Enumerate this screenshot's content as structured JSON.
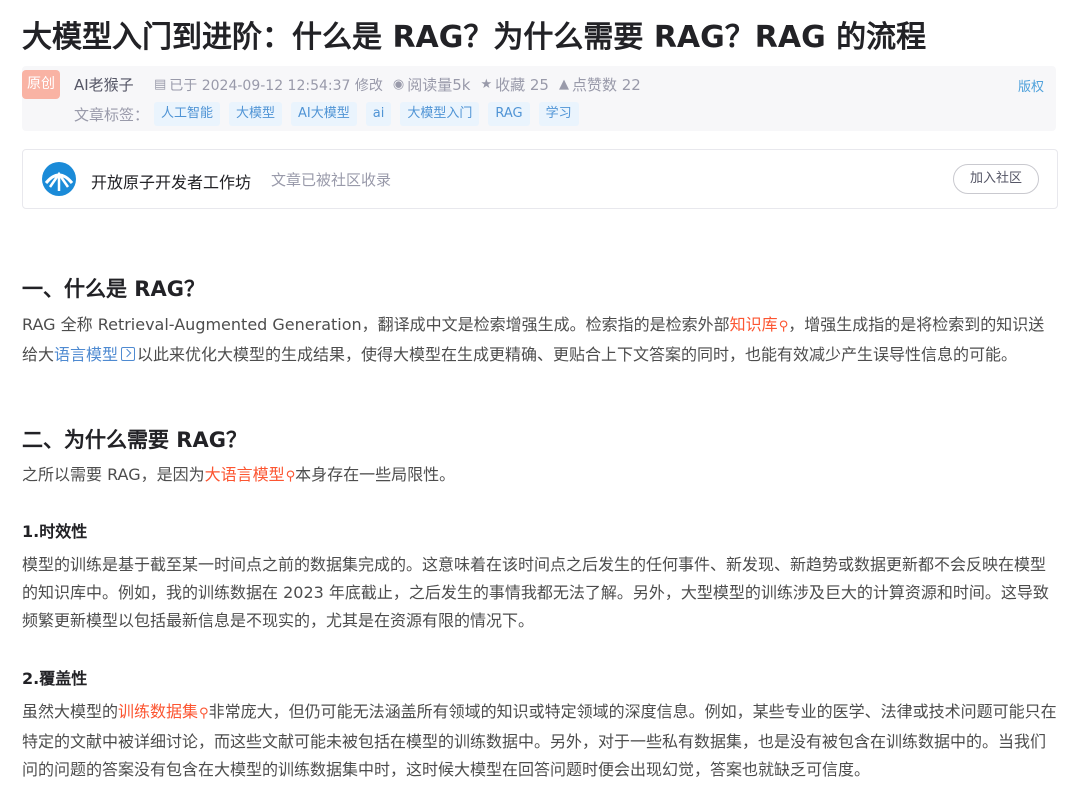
{
  "article": {
    "title": "大模型入门到进阶：什么是 RAG？为什么需要 RAG？RAG 的流程"
  },
  "meta": {
    "badge": "原创",
    "author": "AI老猴子",
    "date": "已于 2024-09-12 12:54:37 修改",
    "views": "阅读量5k",
    "favorites": "收藏 25",
    "likes": "点赞数 22",
    "copyright": "版权",
    "tags_label": "文章标签：",
    "tags": [
      "人工智能",
      "大模型",
      "AI大模型",
      "ai",
      "大模型入门",
      "RAG",
      "学习"
    ]
  },
  "community": {
    "name": "开放原子开发者工作坊",
    "note": "文章已被社区收录",
    "join": "加入社区"
  },
  "content": {
    "s1_title": "一、什么是 RAG？",
    "s1_p1_a": "RAG 全称 Retrieval-Augmented Generation，翻译成中文是检索增强生成。检索指的是检索外部",
    "s1_kw1": "知识库",
    "s1_p1_b": "，增强生成指的是将检索到的知识送给大",
    "s1_kw2": "语言模型",
    "s1_p1_c": "以此来优化大模型的生成结果，使得大模型在生成更精确、更贴合上下文答案的同时，也能有效减少产生误导性信息的可能。",
    "s2_title": "二、为什么需要 RAG？",
    "s2_p1_a": "之所以需要 RAG，是因为",
    "s2_kw1": "大语言模型",
    "s2_p1_b": "本身存在一些局限性。",
    "s2_1_title": "1.时效性",
    "s2_1_text": "模型的训练是基于截至某一时间点之前的数据集完成的。这意味着在该时间点之后发生的任何事件、新发现、新趋势或数据更新都不会反映在模型的知识库中。例如，我的训练数据在 2023 年底截止，之后发生的事情我都无法了解。另外，大型模型的训练涉及巨大的计算资源和时间。这导致频繁更新模型以包括最新信息是不现实的，尤其是在资源有限的情况下。",
    "s2_2_title": "2.覆盖性",
    "s2_2_a": "虽然大模型的",
    "s2_2_kw": "训练数据集",
    "s2_2_b": "非常庞大，但仍可能无法涵盖所有领域的知识或特定领域的深度信息。例如，某些专业的医学、法律或技术问题可能只在特定的文献中被详细讨论，而这些文献可能未被包括在模型的训练数据中。另外，对于一些私有数据集，也是没有被包含在训练数据中的。当我们问的问题的答案没有包含在大模型的训练数据集中时，这时候大模型在回答问题时便会出现幻觉，答案也就缺乏可信度。"
  },
  "colors": {
    "keyword": "#fc5531",
    "link": "#4e8ad1",
    "tag_bg": "#eaf4fd",
    "tag_text": "#5094d5"
  }
}
